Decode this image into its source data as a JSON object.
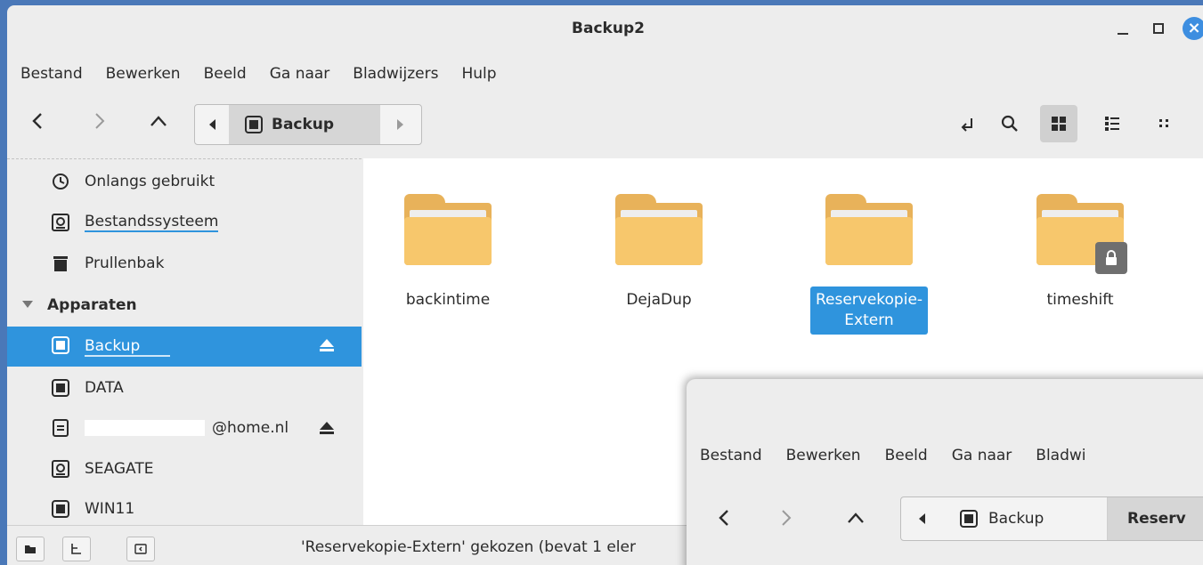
{
  "window": {
    "title": "Backup2"
  },
  "menu": [
    "Bestand",
    "Bewerken",
    "Beeld",
    "Ga naar",
    "Bladwijzers",
    "Hulp"
  ],
  "pathbar": {
    "crumb": "Backup"
  },
  "sidebar": {
    "items": [
      {
        "label": "Onlangs gebruikt",
        "icon": "clock-icon"
      },
      {
        "label": "Bestandssysteem",
        "icon": "drive-icon"
      },
      {
        "label": "Prullenbak",
        "icon": "trash-icon"
      }
    ],
    "section": "Apparaten",
    "devices": [
      {
        "label": "Backup",
        "icon": "chip-icon",
        "eject": true,
        "selected": true
      },
      {
        "label": "DATA",
        "icon": "chip-icon"
      },
      {
        "label": "@home.nl",
        "icon": "network-drive-icon",
        "eject": true,
        "redacted": true
      },
      {
        "label": "SEAGATE",
        "icon": "drive-icon"
      },
      {
        "label": "WIN11",
        "icon": "chip-icon"
      }
    ]
  },
  "files": [
    {
      "name": "backintime"
    },
    {
      "name": "DejaDup"
    },
    {
      "name": "Reservekopie-\nExtern",
      "selected": true
    },
    {
      "name": "timeshift",
      "locked": true
    }
  ],
  "status": {
    "text": "'Reservekopie-Extern' gekozen (bevat 1 eler"
  },
  "second_window": {
    "menu": [
      "Bestand",
      "Bewerken",
      "Beeld",
      "Ga naar",
      "Bladwi"
    ],
    "crumb": "Backup",
    "crumb2": "Reserv"
  },
  "colors": {
    "accent": "#2f94dd",
    "folder": "#f7c76c",
    "desktop": "#4a78b8"
  }
}
